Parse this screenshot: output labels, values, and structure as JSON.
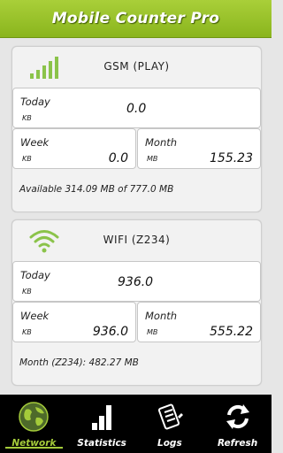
{
  "app": {
    "title": "Mobile Counter Pro"
  },
  "gsm": {
    "name": "GSM (PLAY)",
    "today": {
      "label": "Today",
      "unit": "KB",
      "value": "0.0"
    },
    "week": {
      "label": "Week",
      "unit": "KB",
      "value": "0.0"
    },
    "month": {
      "label": "Month",
      "unit": "MB",
      "value": "155.23"
    },
    "info": "Available 314.09 MB of 777.0 MB"
  },
  "wifi": {
    "name": "WIFI (Z234)",
    "today": {
      "label": "Today",
      "unit": "KB",
      "value": "936.0"
    },
    "week": {
      "label": "Week",
      "unit": "KB",
      "value": "936.0"
    },
    "month": {
      "label": "Month",
      "unit": "MB",
      "value": "555.22"
    },
    "info": "Month (Z234):  482.27 MB"
  },
  "tabs": [
    {
      "label": "Network",
      "icon": "globe-icon",
      "active": true
    },
    {
      "label": "Statistics",
      "icon": "bar-chart-icon",
      "active": false
    },
    {
      "label": "Logs",
      "icon": "logs-icon",
      "active": false
    },
    {
      "label": "Refresh",
      "icon": "refresh-icon",
      "active": false
    }
  ],
  "colors": {
    "accent": "#9fc82e",
    "tabbar": "#000000",
    "background": "#e6e6e6"
  }
}
